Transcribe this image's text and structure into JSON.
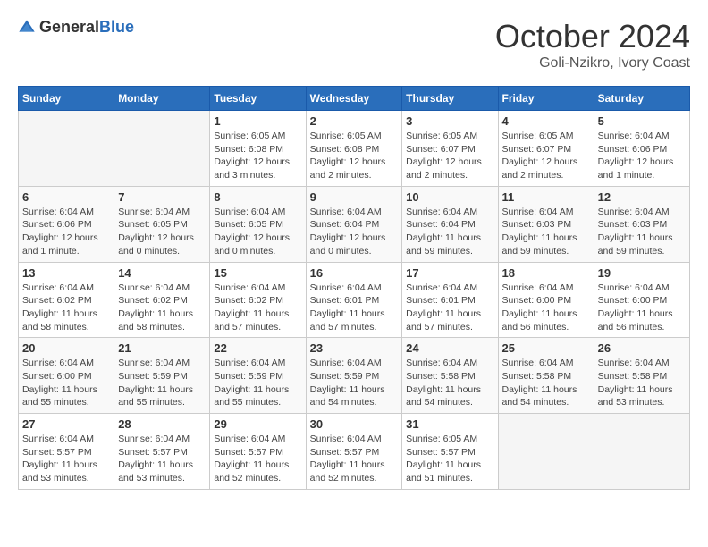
{
  "header": {
    "logo_general": "General",
    "logo_blue": "Blue",
    "month_title": "October 2024",
    "location": "Goli-Nzikro, Ivory Coast"
  },
  "calendar": {
    "days_of_week": [
      "Sunday",
      "Monday",
      "Tuesday",
      "Wednesday",
      "Thursday",
      "Friday",
      "Saturday"
    ],
    "weeks": [
      [
        {
          "day": "",
          "detail": ""
        },
        {
          "day": "",
          "detail": ""
        },
        {
          "day": "1",
          "detail": "Sunrise: 6:05 AM\nSunset: 6:08 PM\nDaylight: 12 hours and 3 minutes."
        },
        {
          "day": "2",
          "detail": "Sunrise: 6:05 AM\nSunset: 6:08 PM\nDaylight: 12 hours and 2 minutes."
        },
        {
          "day": "3",
          "detail": "Sunrise: 6:05 AM\nSunset: 6:07 PM\nDaylight: 12 hours and 2 minutes."
        },
        {
          "day": "4",
          "detail": "Sunrise: 6:05 AM\nSunset: 6:07 PM\nDaylight: 12 hours and 2 minutes."
        },
        {
          "day": "5",
          "detail": "Sunrise: 6:04 AM\nSunset: 6:06 PM\nDaylight: 12 hours and 1 minute."
        }
      ],
      [
        {
          "day": "6",
          "detail": "Sunrise: 6:04 AM\nSunset: 6:06 PM\nDaylight: 12 hours and 1 minute."
        },
        {
          "day": "7",
          "detail": "Sunrise: 6:04 AM\nSunset: 6:05 PM\nDaylight: 12 hours and 0 minutes."
        },
        {
          "day": "8",
          "detail": "Sunrise: 6:04 AM\nSunset: 6:05 PM\nDaylight: 12 hours and 0 minutes."
        },
        {
          "day": "9",
          "detail": "Sunrise: 6:04 AM\nSunset: 6:04 PM\nDaylight: 12 hours and 0 minutes."
        },
        {
          "day": "10",
          "detail": "Sunrise: 6:04 AM\nSunset: 6:04 PM\nDaylight: 11 hours and 59 minutes."
        },
        {
          "day": "11",
          "detail": "Sunrise: 6:04 AM\nSunset: 6:03 PM\nDaylight: 11 hours and 59 minutes."
        },
        {
          "day": "12",
          "detail": "Sunrise: 6:04 AM\nSunset: 6:03 PM\nDaylight: 11 hours and 59 minutes."
        }
      ],
      [
        {
          "day": "13",
          "detail": "Sunrise: 6:04 AM\nSunset: 6:02 PM\nDaylight: 11 hours and 58 minutes."
        },
        {
          "day": "14",
          "detail": "Sunrise: 6:04 AM\nSunset: 6:02 PM\nDaylight: 11 hours and 58 minutes."
        },
        {
          "day": "15",
          "detail": "Sunrise: 6:04 AM\nSunset: 6:02 PM\nDaylight: 11 hours and 57 minutes."
        },
        {
          "day": "16",
          "detail": "Sunrise: 6:04 AM\nSunset: 6:01 PM\nDaylight: 11 hours and 57 minutes."
        },
        {
          "day": "17",
          "detail": "Sunrise: 6:04 AM\nSunset: 6:01 PM\nDaylight: 11 hours and 57 minutes."
        },
        {
          "day": "18",
          "detail": "Sunrise: 6:04 AM\nSunset: 6:00 PM\nDaylight: 11 hours and 56 minutes."
        },
        {
          "day": "19",
          "detail": "Sunrise: 6:04 AM\nSunset: 6:00 PM\nDaylight: 11 hours and 56 minutes."
        }
      ],
      [
        {
          "day": "20",
          "detail": "Sunrise: 6:04 AM\nSunset: 6:00 PM\nDaylight: 11 hours and 55 minutes."
        },
        {
          "day": "21",
          "detail": "Sunrise: 6:04 AM\nSunset: 5:59 PM\nDaylight: 11 hours and 55 minutes."
        },
        {
          "day": "22",
          "detail": "Sunrise: 6:04 AM\nSunset: 5:59 PM\nDaylight: 11 hours and 55 minutes."
        },
        {
          "day": "23",
          "detail": "Sunrise: 6:04 AM\nSunset: 5:59 PM\nDaylight: 11 hours and 54 minutes."
        },
        {
          "day": "24",
          "detail": "Sunrise: 6:04 AM\nSunset: 5:58 PM\nDaylight: 11 hours and 54 minutes."
        },
        {
          "day": "25",
          "detail": "Sunrise: 6:04 AM\nSunset: 5:58 PM\nDaylight: 11 hours and 54 minutes."
        },
        {
          "day": "26",
          "detail": "Sunrise: 6:04 AM\nSunset: 5:58 PM\nDaylight: 11 hours and 53 minutes."
        }
      ],
      [
        {
          "day": "27",
          "detail": "Sunrise: 6:04 AM\nSunset: 5:57 PM\nDaylight: 11 hours and 53 minutes."
        },
        {
          "day": "28",
          "detail": "Sunrise: 6:04 AM\nSunset: 5:57 PM\nDaylight: 11 hours and 53 minutes."
        },
        {
          "day": "29",
          "detail": "Sunrise: 6:04 AM\nSunset: 5:57 PM\nDaylight: 11 hours and 52 minutes."
        },
        {
          "day": "30",
          "detail": "Sunrise: 6:04 AM\nSunset: 5:57 PM\nDaylight: 11 hours and 52 minutes."
        },
        {
          "day": "31",
          "detail": "Sunrise: 6:05 AM\nSunset: 5:57 PM\nDaylight: 11 hours and 51 minutes."
        },
        {
          "day": "",
          "detail": ""
        },
        {
          "day": "",
          "detail": ""
        }
      ]
    ]
  }
}
